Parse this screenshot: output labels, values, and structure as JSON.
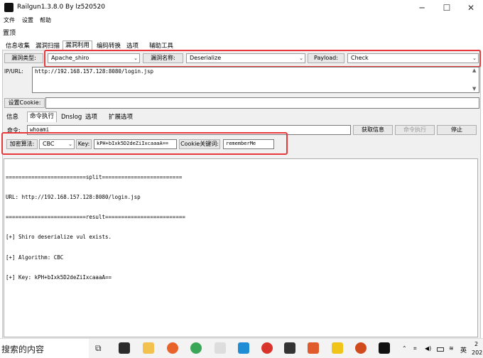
{
  "window": {
    "title": "Railgun1.3.8.0  By  lz520520",
    "minimize": "─",
    "maximize": "☐",
    "close": "✕"
  },
  "menu": [
    "文件",
    "设置",
    "帮助"
  ],
  "toolbar_label": "置顶",
  "main_tabs": [
    "信息收集",
    "漏洞扫描",
    "漏洞利用",
    "编码转换",
    "选项",
    "辅助工具"
  ],
  "vuln": {
    "type_label": "漏洞类型:",
    "type_value": "Apache_shiro",
    "name_label": "漏洞名称:",
    "name_value": "Deserialize",
    "payload_label": "Payload:",
    "payload_value": "Check"
  },
  "ipurl": {
    "label": "IP/URL:",
    "value": "http://192.168.157.128:8080/login.jsp"
  },
  "cookie": {
    "label": "设置Cookie:",
    "value": ""
  },
  "sub_tabs": [
    "信息",
    "命令执行",
    "Dnslog",
    "选项",
    "扩展选项"
  ],
  "command": {
    "label": "命令:",
    "value": "whoami",
    "get_info": "获取信息",
    "exec": "命令执行",
    "stop": "停止"
  },
  "crypto": {
    "algo_label": "加密算法:",
    "algo_value": "CBC",
    "key_label": "Key:",
    "key_value": "kPH+bIxk5D2deZiIxcaaaA==",
    "cookie_kw_label": "Cookie关键词:",
    "cookie_kw_value": "rememberMe"
  },
  "output_lines": [
    "=========================split=========================",
    "URL: http://192.168.157.128:8080/login.jsp",
    "=========================result=========================",
    "[+] Shiro deserialize vul exists.",
    "[+] Algorithm: CBC",
    "[+] Key: kPH+bIxk5D2deZiIxcaaaA=="
  ],
  "taskbar": {
    "search_text": "搜索的内容",
    "tray_lang": "英",
    "clock_line1": "2",
    "clock_line2": "202"
  },
  "colors": {
    "highlight": "#e8383b",
    "panel": "#f0f0f0"
  }
}
